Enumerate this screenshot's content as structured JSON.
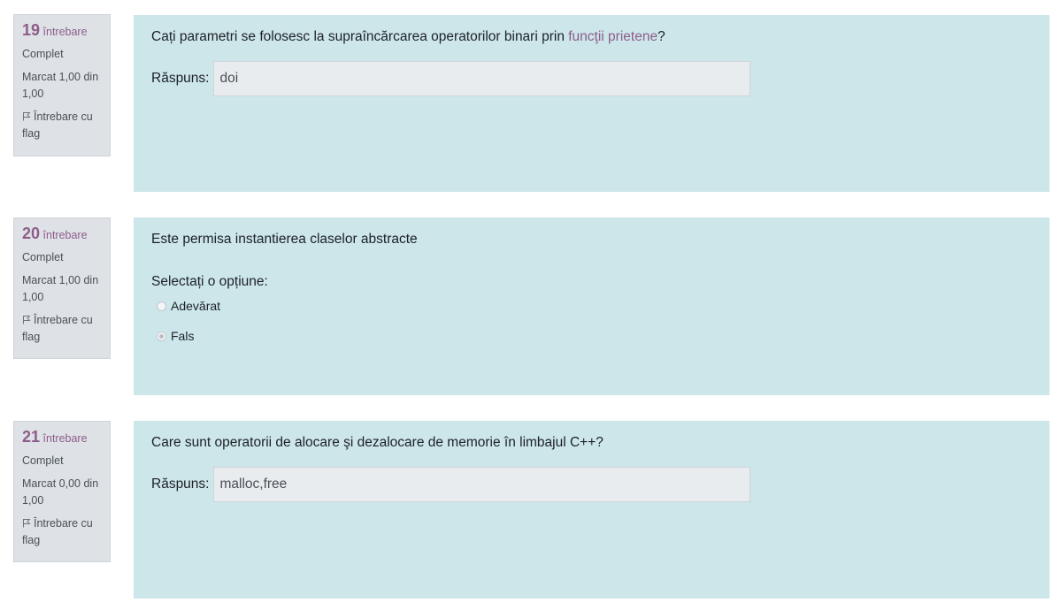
{
  "questions": [
    {
      "number": "19",
      "number_word": "întrebare",
      "state": "Complet",
      "grade": "Marcat 1,00 din 1,00",
      "flag_label": "Întrebare cu flag",
      "text_before": "Cați parametri  se folosesc la supraîncărcarea operatorilor binari prin ",
      "text_link": "funcţii prietene",
      "text_after": "?",
      "answer_label": "Răspuns:",
      "answer_value": "doi"
    },
    {
      "number": "20",
      "number_word": "întrebare",
      "state": "Complet",
      "grade": "Marcat 1,00 din 1,00",
      "flag_label": "Întrebare cu flag",
      "text": "Este permisa instantierea claselor abstracte",
      "prompt": "Selectați o opțiune:",
      "options": [
        {
          "label": "Adevărat",
          "selected": false
        },
        {
          "label": "Fals",
          "selected": true
        }
      ]
    },
    {
      "number": "21",
      "number_word": "întrebare",
      "state": "Complet",
      "grade": "Marcat 0,00 din 1,00",
      "flag_label": "Întrebare cu flag",
      "text": "Care sunt operatorii de alocare şi dezalocare de memorie în limbajul C++?",
      "answer_label": "Răspuns:",
      "answer_value": "malloc,free"
    }
  ],
  "colors": {
    "accent": "#8e5c8a",
    "content_bg": "#cce6ea",
    "info_bg": "#dee2e6",
    "input_bg": "#e9ecef"
  },
  "icons": {
    "flag": "flag-outline-icon"
  }
}
